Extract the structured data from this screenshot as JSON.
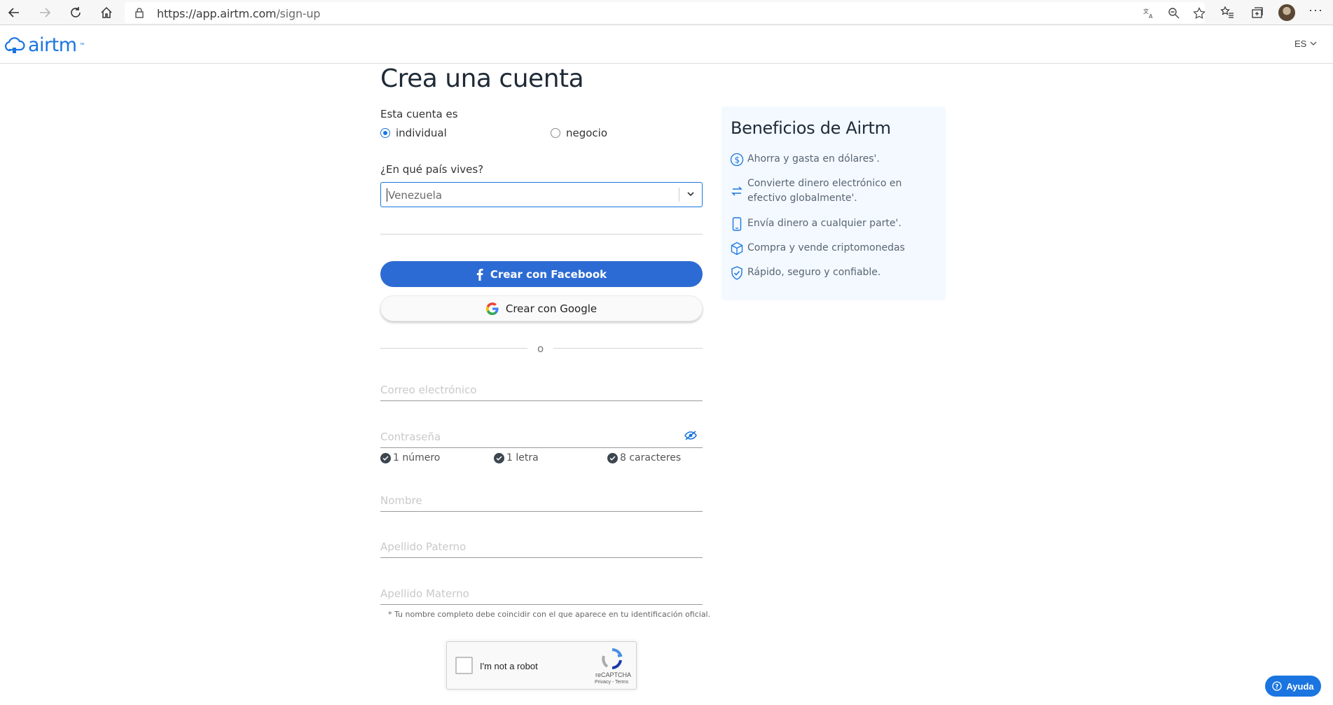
{
  "browser": {
    "url_host": "https://app.airtm.com",
    "url_path": "/sign-up"
  },
  "header": {
    "logo_text": "airtm",
    "logo_tm": "™",
    "language": "ES"
  },
  "form": {
    "title": "Crea una cuenta",
    "account_type_label": "Esta cuenta es",
    "account_types": [
      {
        "label": "individual",
        "selected": true
      },
      {
        "label": "negocio",
        "selected": false
      }
    ],
    "country_label": "¿En qué país vives?",
    "country_value": "Venezuela",
    "facebook_button": "Crear con Facebook",
    "google_button": "Crear con Google",
    "or_text": "o",
    "email_placeholder": "Correo electrónico",
    "password_placeholder": "Contraseña",
    "password_requirements": [
      "1 número",
      "1 letra",
      "8 caracteres"
    ],
    "first_name_placeholder": "Nombre",
    "paternal_surname_placeholder": "Apellido Paterno",
    "maternal_surname_placeholder": "Apellido Materno",
    "name_note": "* Tu nombre completo debe coincidir con el que aparece en tu identificación oficial.",
    "captcha": {
      "label": "I'm not a robot",
      "brand": "reCAPTCHA",
      "links": "Privacy - Terms"
    }
  },
  "benefits": {
    "title": "Beneficios de Airtm",
    "items": [
      {
        "icon": "dollar-icon",
        "text": "Ahorra y gasta en dólares'."
      },
      {
        "icon": "exchange-icon",
        "text": "Convierte dinero electrónico en efectivo globalmente'."
      },
      {
        "icon": "phone-icon",
        "text": "Envía dinero a cualquier parte'."
      },
      {
        "icon": "cube-icon",
        "text": "Compra y vende criptomonedas"
      },
      {
        "icon": "shield-check-icon",
        "text": "Rápido, seguro y confiable."
      }
    ]
  },
  "help_button": "Ayuda",
  "colors": {
    "brand_blue": "#1a75e0",
    "facebook_blue": "#2d6bd4",
    "benefits_bg": "#f3f9ff"
  }
}
